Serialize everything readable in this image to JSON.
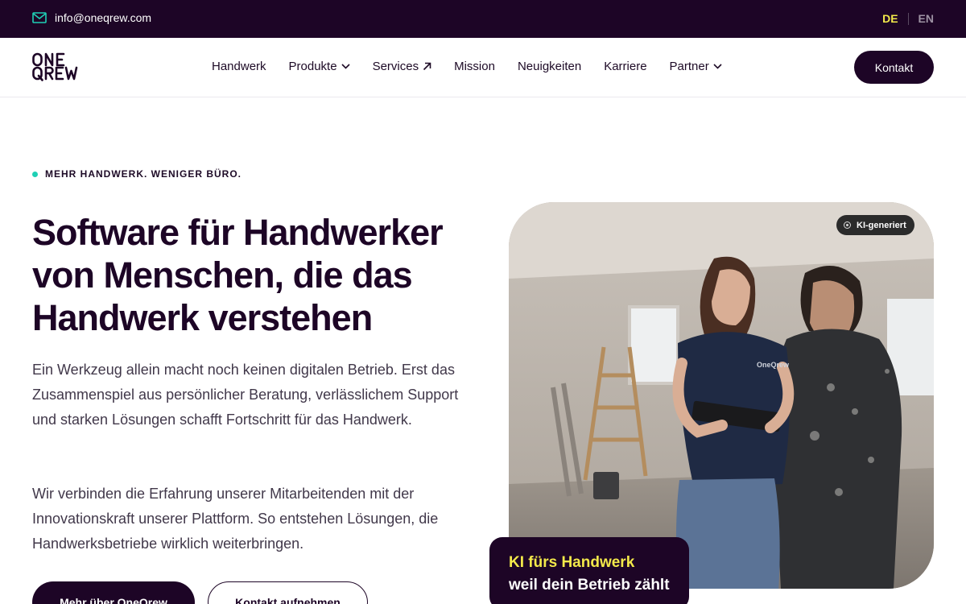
{
  "topbar": {
    "email": "info@oneqrew.com",
    "languages": {
      "active": "DE",
      "other": "EN"
    }
  },
  "nav": {
    "logo": {
      "line1": "ONE",
      "line2": "QREW"
    },
    "items": [
      {
        "label": "Handwerk",
        "icon": ""
      },
      {
        "label": "Produkte",
        "icon": "chevron-down-icon"
      },
      {
        "label": "Services",
        "icon": "arrow-up-right-icon"
      },
      {
        "label": "Mission",
        "icon": ""
      },
      {
        "label": "Neuigkeiten",
        "icon": ""
      },
      {
        "label": "Karriere",
        "icon": ""
      },
      {
        "label": "Partner",
        "icon": "chevron-down-icon"
      }
    ],
    "cta": "Kontakt"
  },
  "hero": {
    "eyebrow": "MEHR HANDWERK. WENIGER BÜRO.",
    "headline": "Software für Handwerker von Menschen, die das Handwerk verstehen",
    "paragraph1": "Ein Werkzeug allein macht noch keinen digitalen Betrieb. Erst das Zusammenspiel aus persönlicher Beratung, verlässlichem Support und starken Lösungen schafft Fortschritt für das Handwerk.",
    "paragraph2": "Wir verbinden die Erfahrung unserer Mitarbeitenden mit der Innovationskraft unserer Plattform. So entstehen Lösungen, die Handwerksbetriebe wirklich weiterbringen.",
    "primary_button": "Mehr über OneQrew",
    "secondary_button": "Kontakt aufnehmen",
    "image_badge": "KI-generiert",
    "caption": {
      "line1": "KI fürs Handwerk",
      "line2": "weil dein Betrieb zählt"
    }
  },
  "colors": {
    "brand_dark": "#1d0526",
    "accent_yellow": "#f3e94a",
    "accent_teal": "#1fd0b5"
  }
}
